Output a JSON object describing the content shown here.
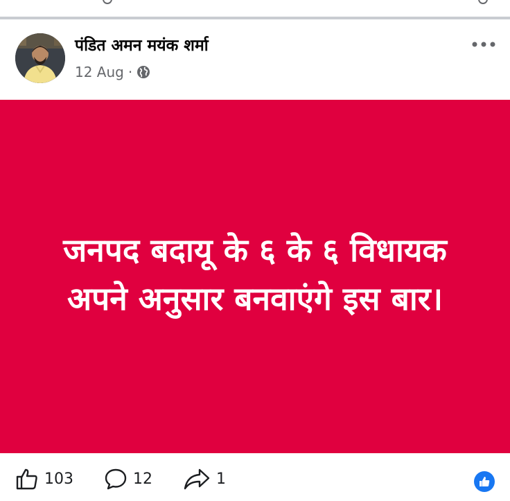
{
  "post": {
    "author_name": "पंडित अमन मयंक शर्मा",
    "date": "12 Aug",
    "separator": "·",
    "privacy_icon": "globe-icon",
    "more_icon": "more-horizontal-icon",
    "more_label": "•••",
    "card_background": "#e0003f",
    "card_text": "जनपद बदायू के ६ के ६ विधायक अपने अनुसार बनवाएंगे इस बार।"
  },
  "actions": {
    "likes_count": "103",
    "comments_count": "12",
    "shares_count": "1",
    "like_icon": "thumbs-up-icon",
    "comment_icon": "comment-icon",
    "share_icon": "share-icon",
    "reaction_badge_icon": "like-reaction-badge-icon",
    "reaction_color": "#1877f2"
  }
}
